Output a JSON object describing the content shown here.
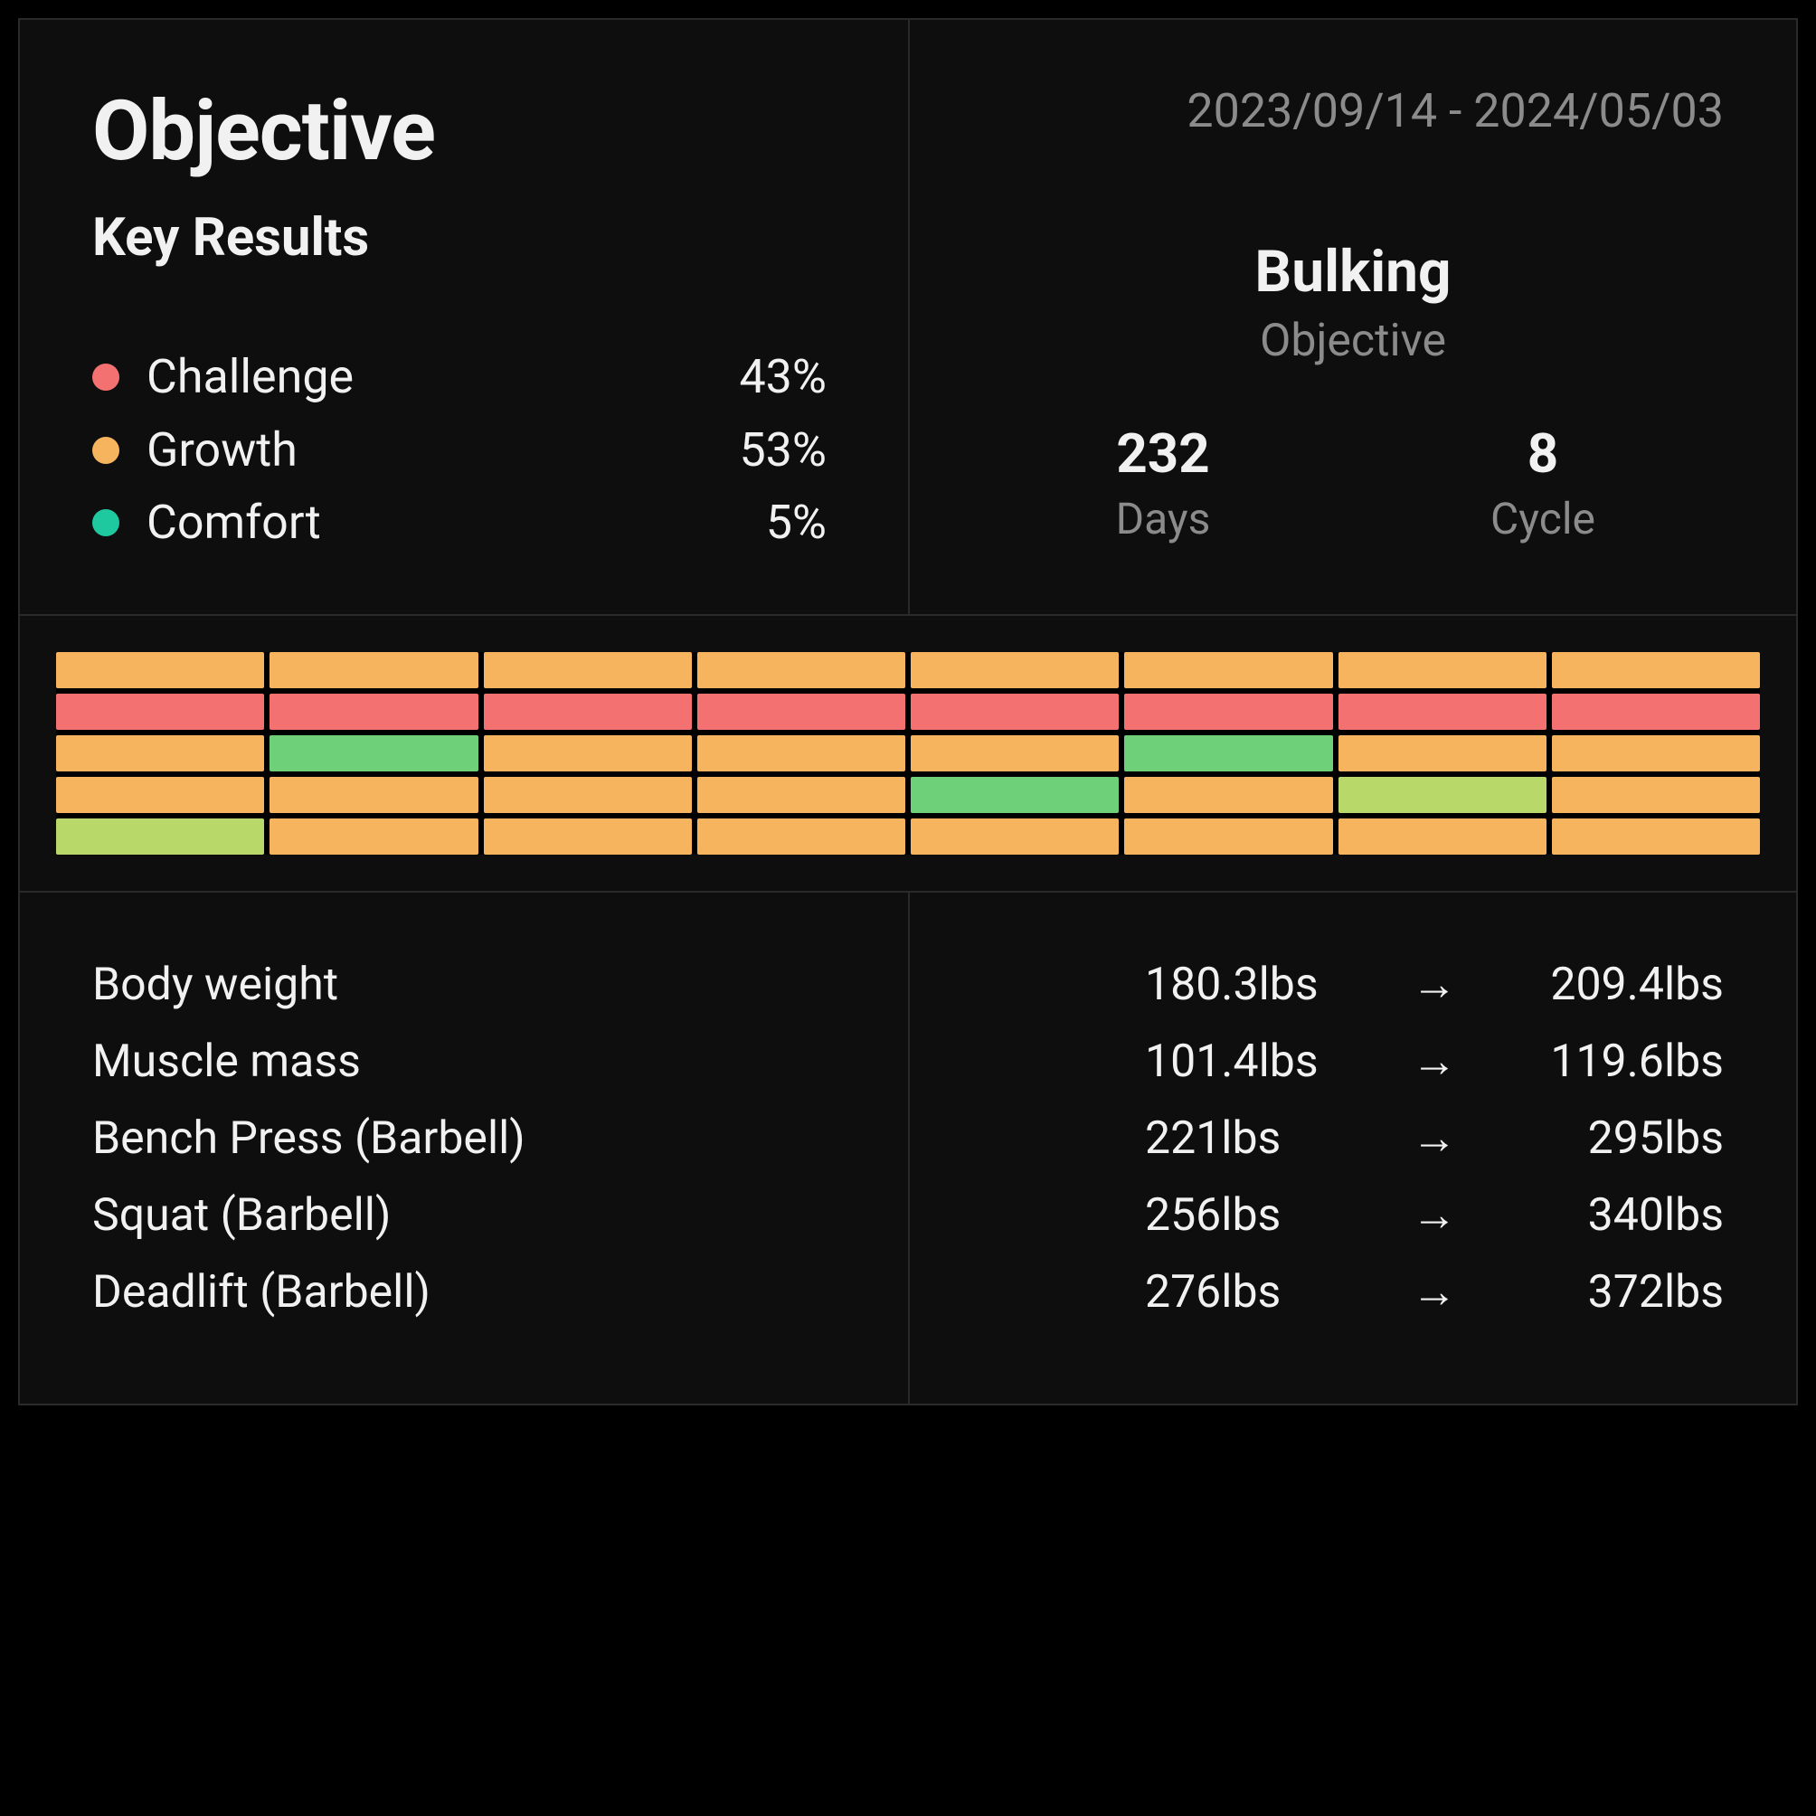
{
  "header": {
    "title": "Objective",
    "subtitle": "Key Results"
  },
  "keyResults": [
    {
      "label": "Challenge",
      "value": "43%",
      "color": "#f47171"
    },
    {
      "label": "Growth",
      "value": "53%",
      "color": "#f6b45e"
    },
    {
      "label": "Comfort",
      "value": "5%",
      "color": "#1fc9a0"
    }
  ],
  "dateRange": "2023/09/14 - 2024/05/03",
  "objective": {
    "name": "Bulking",
    "sub": "Objective"
  },
  "stats": {
    "days": {
      "value": "232",
      "label": "Days"
    },
    "cycle": {
      "value": "8",
      "label": "Cycle"
    }
  },
  "chart_data": {
    "type": "heatmap",
    "title": "",
    "xlabel": "",
    "ylabel": "",
    "rows": 5,
    "cols": 8,
    "cells": [
      [
        "orange",
        "orange",
        "orange",
        "orange",
        "orange",
        "orange",
        "orange",
        "orange"
      ],
      [
        "red",
        "red",
        "red",
        "red",
        "red",
        "red",
        "red",
        "red"
      ],
      [
        "orange",
        "green",
        "orange",
        "orange",
        "orange",
        "green",
        "orange",
        "orange"
      ],
      [
        "orange",
        "orange",
        "orange",
        "orange",
        "green",
        "orange",
        "yellowgreen",
        "orange"
      ],
      [
        "yellowgreen",
        "orange",
        "orange",
        "orange",
        "orange",
        "orange",
        "orange",
        "orange"
      ]
    ],
    "palette": {
      "red": "#f47171",
      "orange": "#f6b45e",
      "green": "#6fd07a",
      "yellowgreen": "#b8d96a"
    }
  },
  "arrowGlyph": "→",
  "metrics": [
    {
      "label": "Body weight",
      "from": "180.3lbs",
      "to": "209.4lbs"
    },
    {
      "label": "Muscle mass",
      "from": "101.4lbs",
      "to": "119.6lbs"
    },
    {
      "label": "Bench Press (Barbell)",
      "from": "221lbs",
      "to": "295lbs"
    },
    {
      "label": "Squat (Barbell)",
      "from": "256lbs",
      "to": "340lbs"
    },
    {
      "label": "Deadlift (Barbell)",
      "from": "276lbs",
      "to": "372lbs"
    }
  ]
}
